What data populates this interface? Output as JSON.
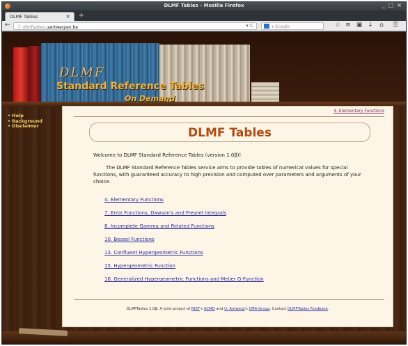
{
  "window": {
    "title": "DLMF Tables - Mozilla Firefox",
    "controls": [
      "_",
      "□",
      "×"
    ]
  },
  "tabs": [
    {
      "label": "DLMF Tables",
      "close": "×"
    }
  ],
  "new_tab_label": "+",
  "nav": {
    "back_icon": "back-arrow-icon",
    "url_prefix": "dlmftables.",
    "url_host": "uantwerpen.be",
    "reload_glyph": "▾ C",
    "search_placeholder": "▾ Google"
  },
  "toolbar_icons": [
    "bookmark-star-icon",
    "reader-icon",
    "save-icon",
    "download-icon",
    "home-icon",
    "menu-icon"
  ],
  "sidebar": {
    "items": [
      {
        "label": "Help"
      },
      {
        "label": "Background"
      },
      {
        "label": "Disclaimer"
      }
    ]
  },
  "banner": {
    "logo_dlmf": "DLMF",
    "logo_sub": "Standard Reference Tables",
    "logo_ondemand": "On Demand"
  },
  "content": {
    "top_link": "4. Elementary Functions",
    "title": "DLMF Tables",
    "welcome": "Welcome to DLMF Standard Reference Tables (version 1.0β)!",
    "intro": "The DLMF Standard Reference Tables service aims to provide tables of numerical values for special functions, with guaranteed accuracy to high precision and computed over parameters and arguments of your choice.",
    "links": [
      {
        "label": "4. Elementary Functions"
      },
      {
        "label": "7. Error Functions, Dawson's and Fresnel Integrals"
      },
      {
        "label": "8. Incomplete Gamma and Related Functions"
      },
      {
        "label": "10. Bessel Functions"
      },
      {
        "label": "13. Confluent Hypergeometric Functions"
      },
      {
        "label": "15. Hypergeometric Function"
      },
      {
        "label": "16. Generalized Hypergeometric Functions and Meijer G-Function"
      }
    ],
    "footer": {
      "prefix": "DLMFTables 1.0β; A joint project of ",
      "nist": "NIST",
      "s1": "'s ",
      "acmd": "ACMD",
      "and": " and ",
      "antwerp": "U. Antwerp",
      "s2": "'s ",
      "cma": "CMA Group",
      "contact": "; Contact ",
      "feedback": "DLMFTables Feedback",
      "end": "."
    }
  },
  "colors": {
    "title": "#b44b12",
    "link": "#2a2aa8",
    "visited_link": "#7a1e6a",
    "sidebar_link": "#f3d66a",
    "logo_gold": "#f0b33c",
    "content_bg": "#fdf6e6"
  }
}
